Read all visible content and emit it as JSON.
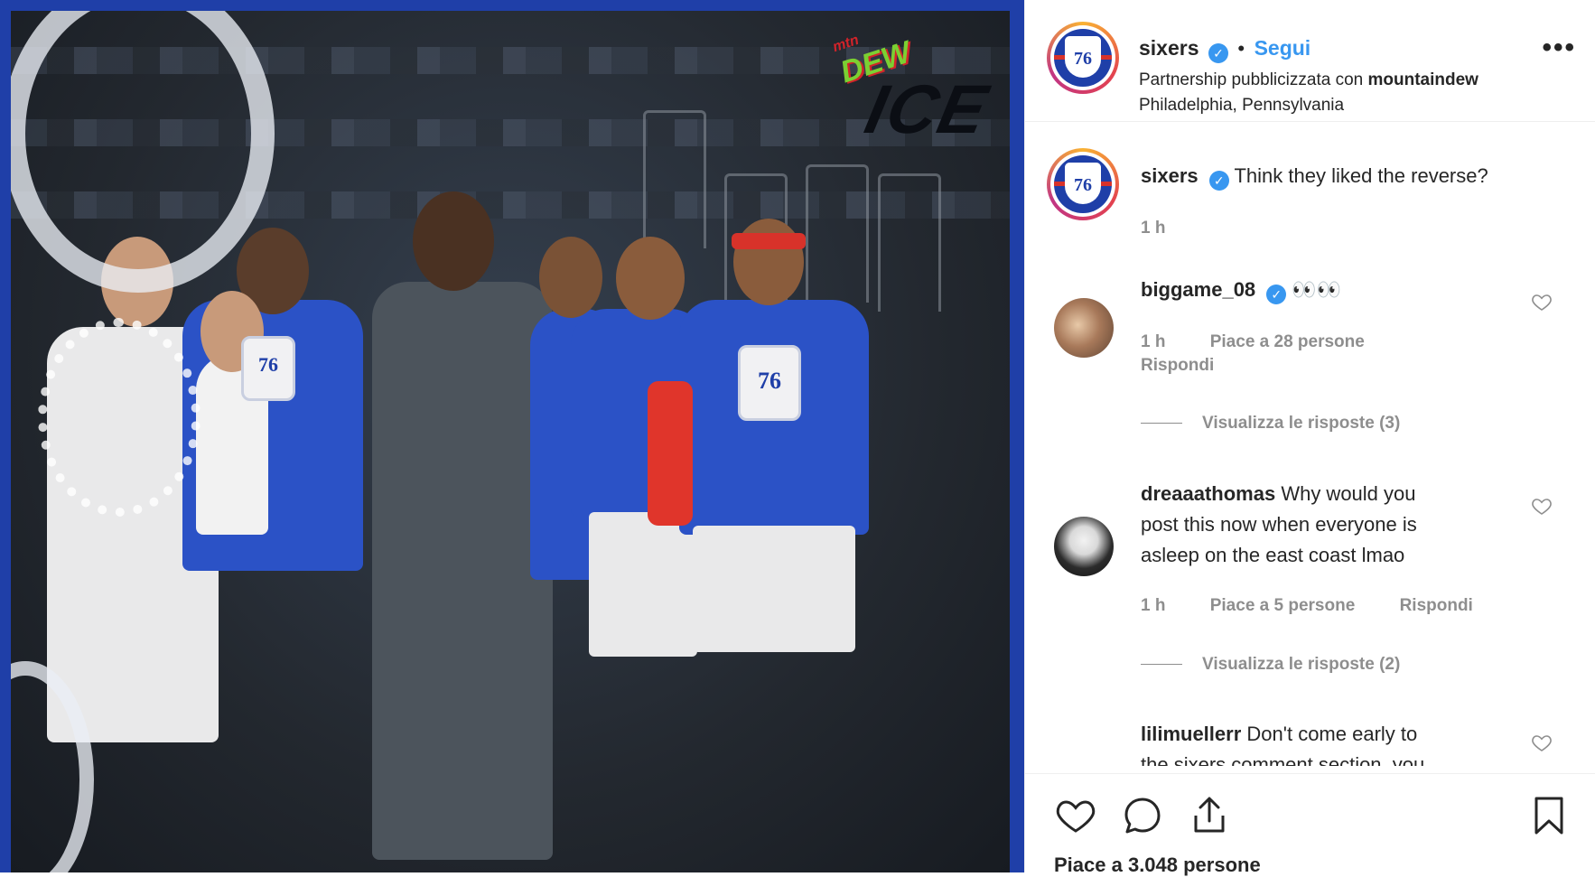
{
  "post": {
    "username": "sixers",
    "follow_label": "Segui",
    "follow_separator": "•",
    "partnership_prefix": "Partnership pubblicizzata con",
    "partner": "mountaindew",
    "location": "Philadelphia, Pennsylvania",
    "brand_logo": {
      "mtn": "mtn",
      "dew": "DEW",
      "ice": "ICE"
    },
    "avatar_logo_text": "76"
  },
  "caption": {
    "username": "sixers",
    "text": "Think they liked the reverse?",
    "time": "1 h"
  },
  "comments": [
    {
      "username": "biggame_08",
      "text": "👀👀",
      "time": "1 h",
      "likes": "Piace a 28 persone",
      "reply": "Rispondi",
      "view_replies": "Visualizza le risposte (3)"
    },
    {
      "username": "dreaaathomas",
      "text_line1": "Why would you",
      "text_line2": "post this now when everyone is",
      "text_line3": "asleep on the east coast lmao",
      "time": "1 h",
      "likes": "Piace a 5 persone",
      "reply": "Rispondi",
      "view_replies": "Visualizza le risposte (2)"
    },
    {
      "username": "lilimuellerr",
      "text_line1": "Don't come early to",
      "text_line2": "the sixers comment section, you"
    }
  ],
  "footer": {
    "likes_text": "Piace a 3.048 persone"
  },
  "icons": {
    "like": "heart-icon",
    "comment": "comment-icon",
    "share": "share-icon",
    "save": "bookmark-icon",
    "more": "more-options-icon",
    "verified": "verified-badge-icon"
  },
  "colors": {
    "link_blue": "#3897f0",
    "muted": "#8e8e8e",
    "text": "#262626",
    "sixers_blue": "#1f3fa8",
    "sixers_red": "#d8322a"
  }
}
